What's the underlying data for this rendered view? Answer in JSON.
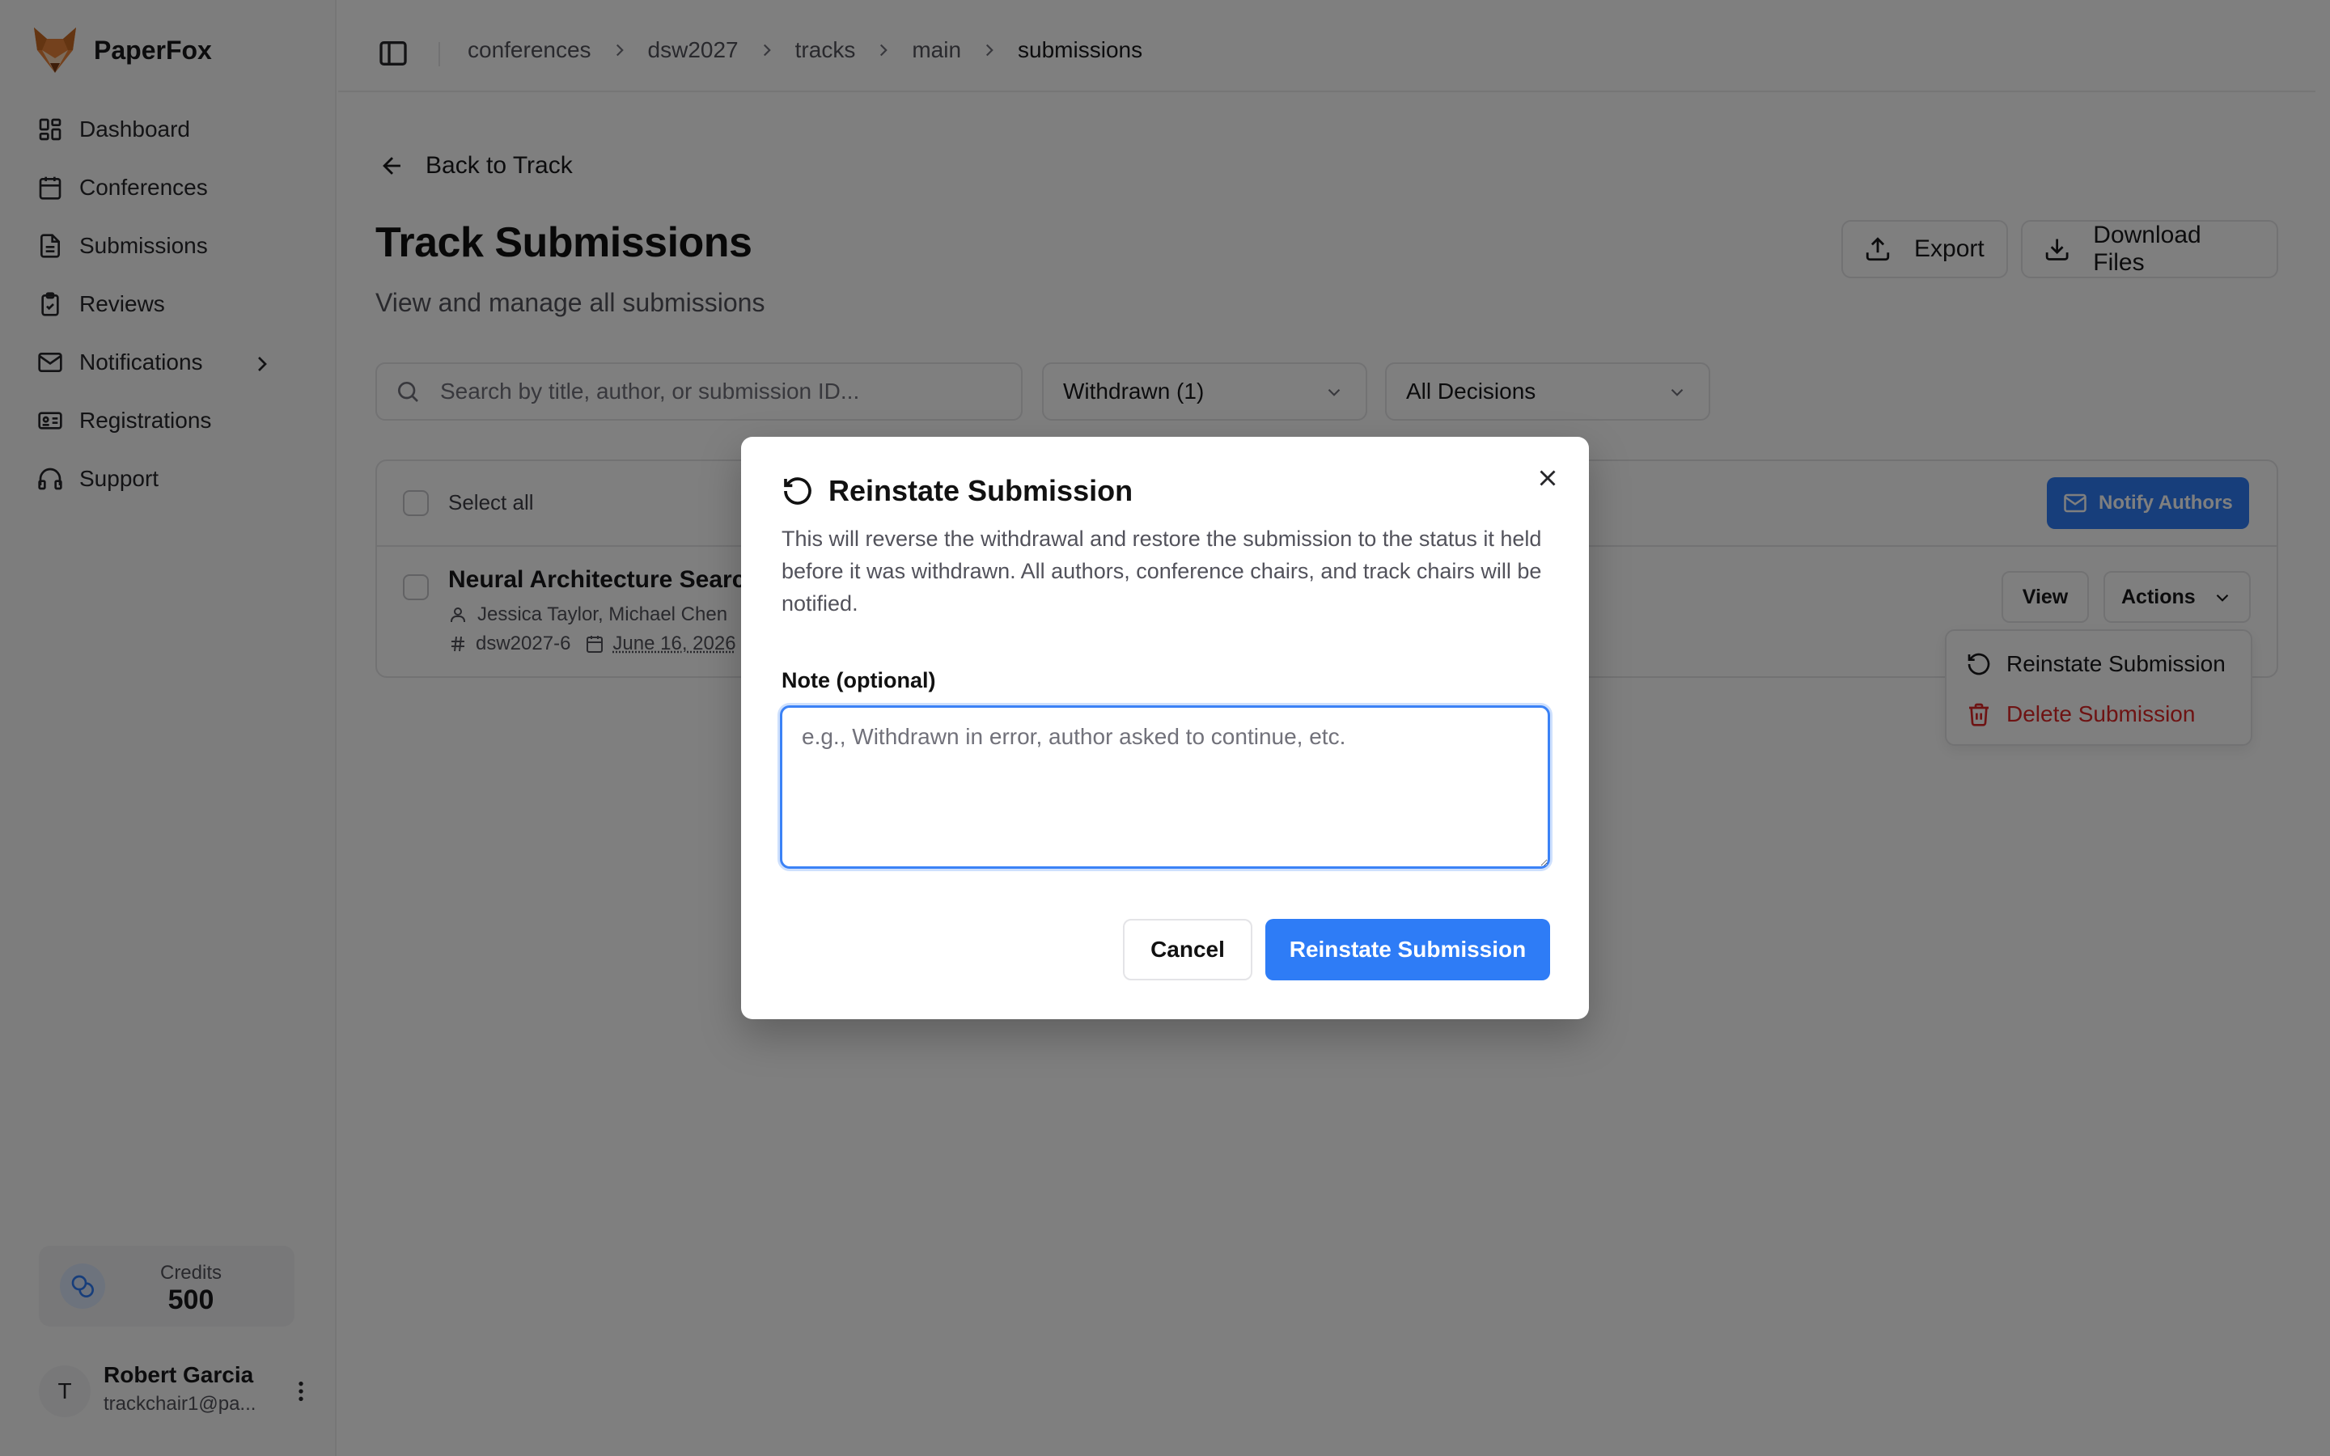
{
  "app": {
    "name": "PaperFox"
  },
  "sidebar": {
    "items": [
      {
        "label": "Dashboard",
        "icon": "dashboard-icon"
      },
      {
        "label": "Conferences",
        "icon": "calendar-icon"
      },
      {
        "label": "Submissions",
        "icon": "file-text-icon"
      },
      {
        "label": "Reviews",
        "icon": "clipboard-check-icon"
      },
      {
        "label": "Notifications",
        "icon": "mail-icon"
      },
      {
        "label": "Registrations",
        "icon": "id-card-icon"
      },
      {
        "label": "Support",
        "icon": "headphones-icon"
      }
    ],
    "credits": {
      "label": "Credits",
      "value": "500"
    },
    "user": {
      "initial": "T",
      "name": "Robert Garcia",
      "email": "trackchair1@pa..."
    }
  },
  "breadcrumb": [
    "conferences",
    "dsw2027",
    "tracks",
    "main",
    "submissions"
  ],
  "page": {
    "back_label": "Back to Track",
    "title": "Track Submissions",
    "subtitle": "View and manage all submissions",
    "export_label": "Export",
    "download_label": "Download Files"
  },
  "filters": {
    "search_placeholder": "Search by title, author, or submission ID...",
    "status_value": "Withdrawn (1)",
    "decision_value": "All Decisions"
  },
  "table": {
    "select_all_label": "Select all",
    "notify_label": "Notify Authors",
    "rows": [
      {
        "title": "Neural Architecture Search",
        "authors": "Jessica Taylor, Michael Chen",
        "id": "dsw2027-6",
        "date": "June 16, 2026",
        "view_label": "View",
        "actions_label": "Actions"
      }
    ]
  },
  "actions_menu": {
    "items": [
      {
        "label": "Reinstate Submission"
      },
      {
        "label": "Delete Submission"
      }
    ]
  },
  "dialog": {
    "title": "Reinstate Submission",
    "description": "This will reverse the withdrawal and restore the submission to the status it held before it was withdrawn. All authors, conference chairs, and track chairs will be notified.",
    "note_label": "Note (optional)",
    "note_placeholder": "e.g., Withdrawn in error, author asked to continue, etc.",
    "cancel_label": "Cancel",
    "confirm_label": "Reinstate Submission"
  },
  "colors": {
    "primary": "#2e7cf6",
    "danger": "#dc2626",
    "overlay": "rgba(0,0,0,0.5)"
  }
}
